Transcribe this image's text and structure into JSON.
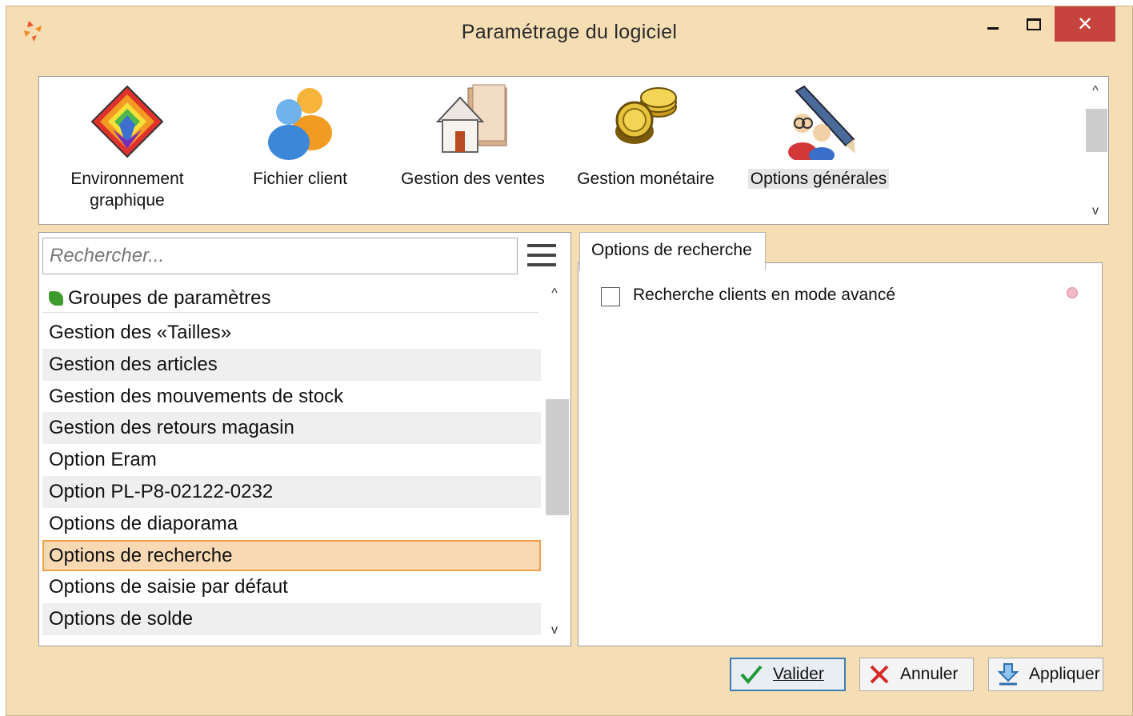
{
  "window": {
    "title": "Paramétrage du logiciel",
    "close_glyph": "✕"
  },
  "ribbon": {
    "items": [
      {
        "label": "Environnement graphique",
        "icon": "environment-pyramid-icon"
      },
      {
        "label": "Fichier client",
        "icon": "users-icon"
      },
      {
        "label": "Gestion des ventes",
        "icon": "house-folder-icon"
      },
      {
        "label": "Gestion monétaire",
        "icon": "coins-icon"
      },
      {
        "label": "Options générales",
        "icon": "people-pencil-icon",
        "selected": true
      }
    ],
    "scroll_up": "^",
    "scroll_down": "v"
  },
  "left": {
    "search_placeholder": "Rechercher...",
    "group_header": "Groupes de paramètres",
    "items": [
      "Gestion des «Tailles»",
      "Gestion des articles",
      "Gestion des mouvements de stock",
      "Gestion des retours magasin",
      "Option Eram",
      "Option PL-P8-02122-0232",
      "Options de diaporama",
      "Options de recherche",
      "Options de saisie par défaut",
      "Options de solde"
    ],
    "selected_index": 7,
    "scroll_up": "^",
    "scroll_down": "v"
  },
  "right": {
    "tab_label": "Options de recherche",
    "checkbox_label": "Recherche clients en mode avancé",
    "checkbox_checked": false,
    "status_color": "#f2b9c6"
  },
  "buttons": {
    "validate": {
      "label": "Valider"
    },
    "cancel": {
      "label": "Annuler"
    },
    "apply": {
      "label": "Appliquer"
    }
  },
  "colors": {
    "window_bg": "#f5deb3",
    "selection_bg": "#f8d9b4",
    "selection_border": "#f0a048",
    "close_bg": "#c7433d"
  }
}
